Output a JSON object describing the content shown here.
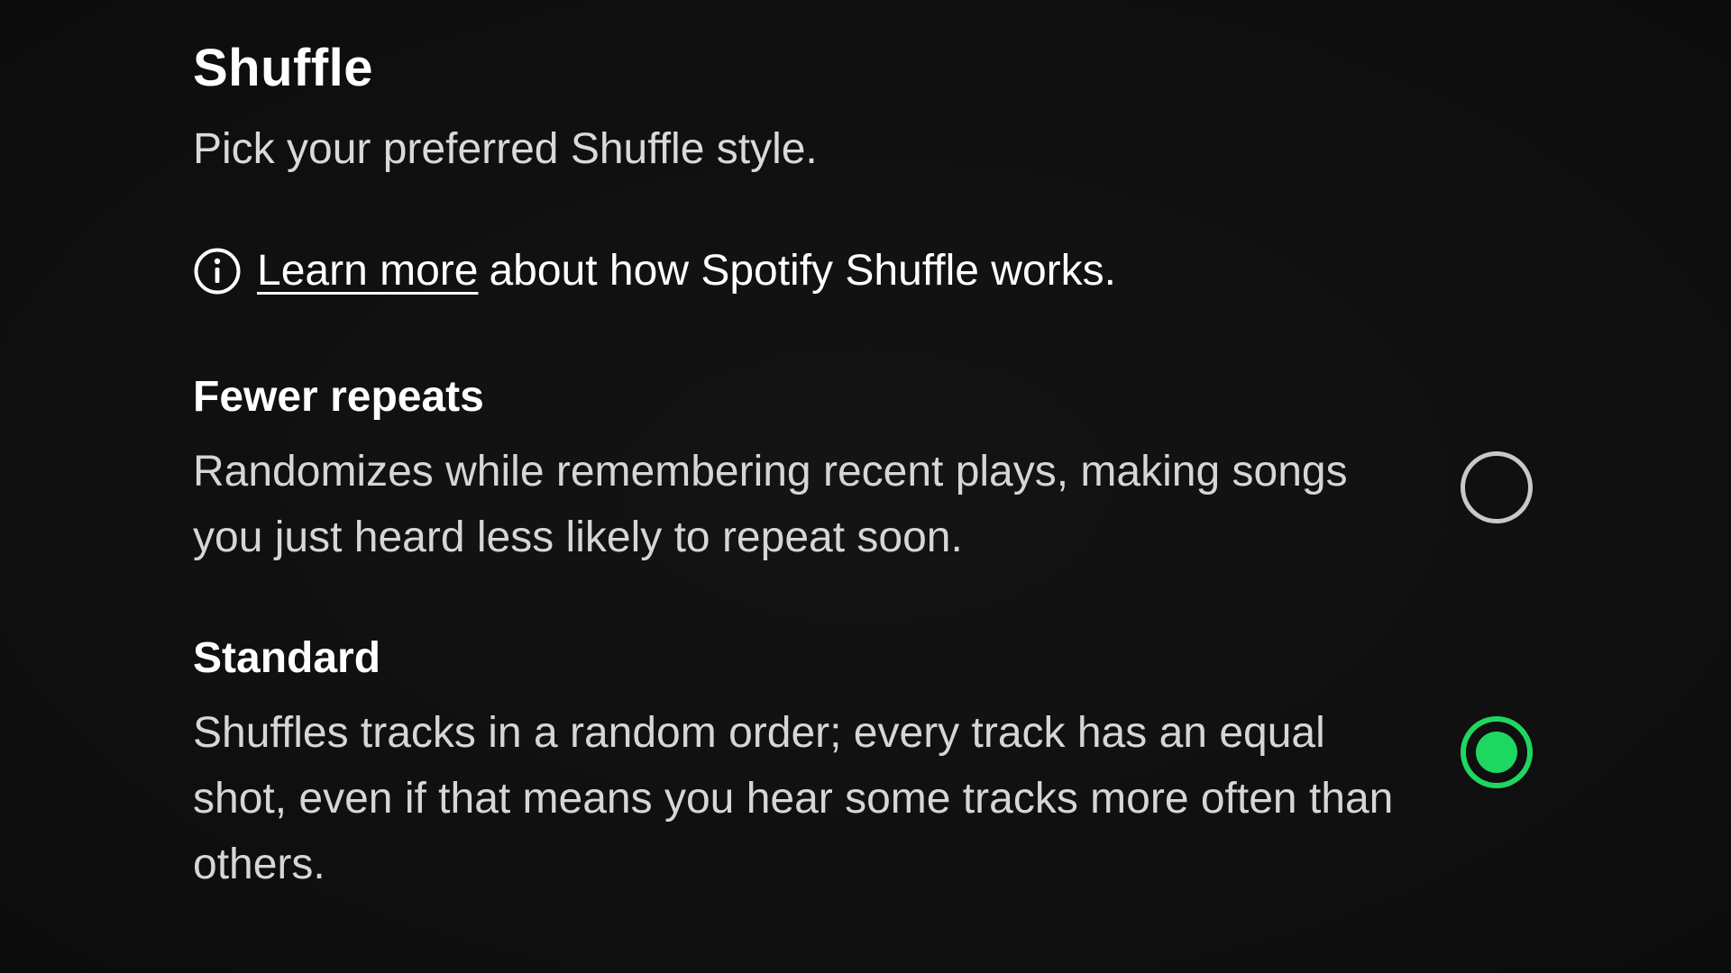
{
  "header": {
    "title": "Shuffle",
    "subtitle": "Pick your preferred Shuffle style."
  },
  "info": {
    "icon": "info-icon",
    "link_text": "Learn more",
    "rest_text": "about how Spotify Shuffle works."
  },
  "options": [
    {
      "title": "Fewer repeats",
      "description": "Randomizes while remembering recent plays, making songs you just heard less likely to repeat soon.",
      "selected": false
    },
    {
      "title": "Standard",
      "description": "Shuffles tracks in a random order; every track has an equal shot, even if that means you hear some tracks more often than others.",
      "selected": true
    }
  ],
  "colors": {
    "background": "#101010",
    "accent": "#1ed760",
    "radio_off": "#c8c8c8",
    "text_primary": "#ffffff",
    "text_secondary": "#d6d6d6"
  }
}
